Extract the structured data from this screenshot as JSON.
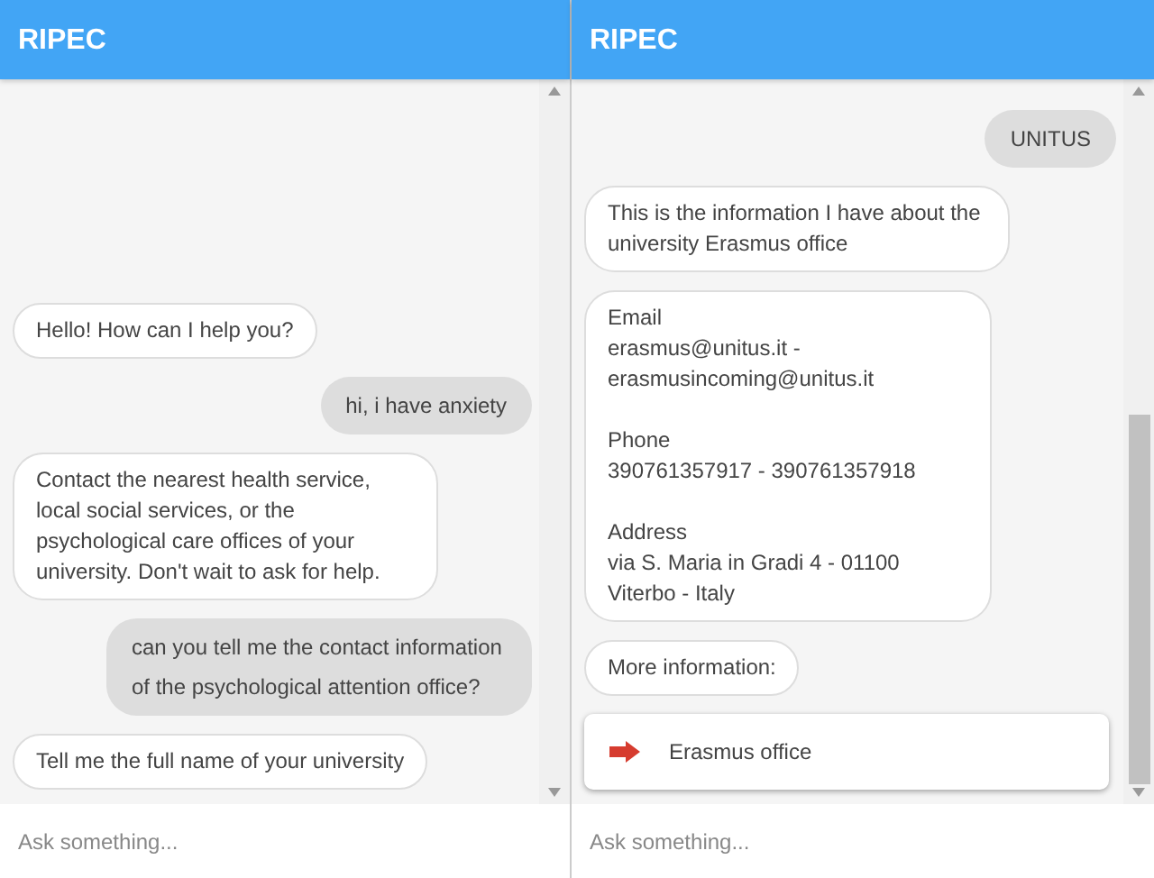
{
  "panels": [
    {
      "title": "RIPEC",
      "messages": [
        {
          "kind": "bot",
          "text": "Hello! How can I help you?"
        },
        {
          "kind": "user",
          "text": "hi, i have anxiety"
        },
        {
          "kind": "bot",
          "text": "Contact the nearest health service, local social services, or the psychological care offices of your university. Don't wait to ask for help."
        },
        {
          "kind": "user",
          "text": "can you tell me the contact information of the psychological attention office?"
        },
        {
          "kind": "bot",
          "text": "Tell me the full name of your university"
        }
      ],
      "input": {
        "placeholder": "Ask something..."
      }
    },
    {
      "title": "RIPEC",
      "messages": [
        {
          "kind": "user",
          "text": "UNITUS"
        },
        {
          "kind": "bot",
          "text": "This is the information I have about the university Erasmus office"
        },
        {
          "kind": "info",
          "paragraphs": [
            {
              "label": "Email",
              "lines": [
                "erasmus@unitus.it -",
                "erasmusincoming@unitus.it"
              ]
            },
            {
              "label": "Phone",
              "lines": [
                "390761357917 - 390761357918"
              ]
            },
            {
              "label": "Address",
              "lines": [
                "via S. Maria in Gradi 4 - 01100",
                "Viterbo - Italy"
              ]
            }
          ]
        },
        {
          "kind": "bot",
          "text": "More information:"
        },
        {
          "kind": "link",
          "text": "Erasmus office"
        }
      ],
      "input": {
        "placeholder": "Ask something..."
      }
    }
  ]
}
